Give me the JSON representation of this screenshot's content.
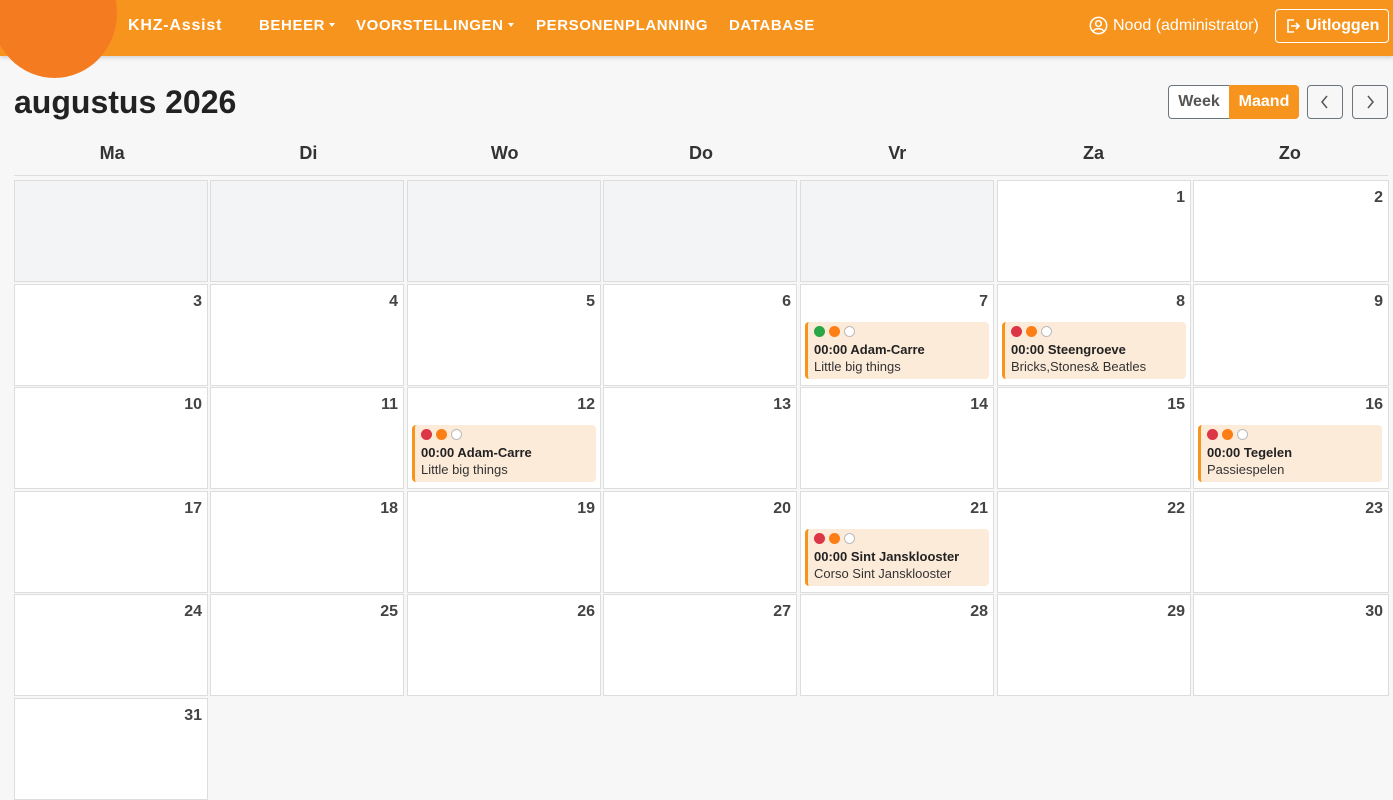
{
  "nav": {
    "brand": "KHZ-Assist",
    "items": [
      {
        "label": "BEHEER",
        "dropdown": true
      },
      {
        "label": "VOORSTELLINGEN",
        "dropdown": true
      },
      {
        "label": "PERSONENPLANNING",
        "dropdown": false
      },
      {
        "label": "DATABASE",
        "dropdown": false
      }
    ],
    "user": "Nood (administrator)",
    "logout": "Uitloggen"
  },
  "calendar": {
    "title": "augustus 2026",
    "views": {
      "week": "Week",
      "month": "Maand",
      "active": "month"
    },
    "weekdays": [
      "Ma",
      "Di",
      "Wo",
      "Do",
      "Vr",
      "Za",
      "Zo"
    ],
    "days": [
      "1",
      "2",
      "3",
      "4",
      "5",
      "6",
      "7",
      "8",
      "9",
      "10",
      "11",
      "12",
      "13",
      "14",
      "15",
      "16",
      "17",
      "18",
      "19",
      "20",
      "21",
      "22",
      "23",
      "24",
      "25",
      "26",
      "27",
      "28",
      "29",
      "30",
      "31"
    ],
    "events": [
      {
        "day": "7",
        "time_title": "00:00 Adam-Carre",
        "subtitle": "Little big things",
        "status": [
          "green",
          "orange",
          "white"
        ]
      },
      {
        "day": "8",
        "time_title": "00:00 Steengroeve",
        "subtitle": "Bricks,Stones& Beatles",
        "status": [
          "red",
          "orange",
          "white"
        ]
      },
      {
        "day": "12",
        "time_title": "00:00 Adam-Carre",
        "subtitle": "Little big things",
        "status": [
          "red",
          "orange",
          "white"
        ]
      },
      {
        "day": "16",
        "time_title": "00:00 Tegelen",
        "subtitle": "Passiespelen",
        "status": [
          "red",
          "orange",
          "white"
        ]
      },
      {
        "day": "21",
        "time_title": "00:00 Sint Jansklooster",
        "subtitle": "Corso Sint Jansklooster",
        "status": [
          "red",
          "orange",
          "white"
        ]
      }
    ]
  },
  "colors": {
    "accent": "#f7941d",
    "brand_blob": "#f47b20",
    "event_bg": "#fdebd9",
    "status_red": "#dc3545",
    "status_orange": "#fd7e14",
    "status_green": "#28a745"
  },
  "icons": {
    "user": "user-circle-icon",
    "logout": "logout-icon",
    "prev": "chevron-left-icon",
    "next": "chevron-right-icon"
  }
}
